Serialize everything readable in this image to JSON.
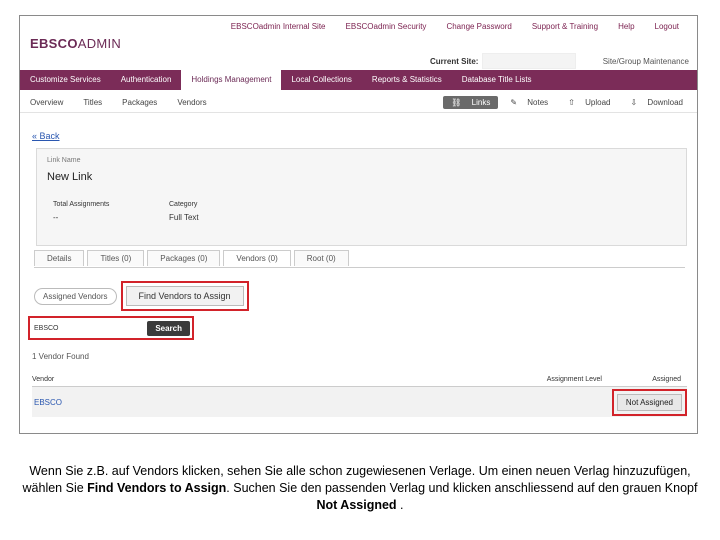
{
  "top_links": [
    "EBSCOadmin Internal Site",
    "EBSCOadmin Security",
    "Change Password",
    "Support & Training",
    "Help",
    "Logout"
  ],
  "logo": {
    "bold": "EBSCO",
    "thin": "ADMIN"
  },
  "current_site_label": "Current Site:",
  "site_group_maintenance": "Site/Group Maintenance",
  "main_nav": [
    "Customize Services",
    "Authentication",
    "Holdings Management",
    "Local Collections",
    "Reports & Statistics",
    "Database Title Lists"
  ],
  "main_nav_active": "Holdings Management",
  "sub_nav": [
    "Overview",
    "Titles",
    "Packages",
    "Vendors"
  ],
  "sub_nav_right": {
    "links": "Links",
    "notes": "Notes",
    "upload": "Upload",
    "download": "Download"
  },
  "back_label": "Back",
  "link_name_label": "Link Name",
  "link_name_value": "New Link",
  "total_assignments_label": "Total Assignments",
  "total_assignments_value": "--",
  "category_label": "Category",
  "category_value": "Full Text",
  "tabs": [
    "Details",
    "Titles (0)",
    "Packages (0)",
    "Vendors (0)",
    "Root (0)"
  ],
  "active_tab": "Vendors (0)",
  "assigned_vendors_label": "Assigned Vendors",
  "find_vendors_label": "Find Vendors to Assign",
  "search_value": "EBSCO",
  "search_button": "Search",
  "found_text": "1 Vendor Found",
  "table_headers": {
    "vendor": "Vendor",
    "assignment_level": "Assignment Level",
    "assigned": "Assigned"
  },
  "rows": [
    {
      "vendor": "EBSCO",
      "assigned_button": "Not Assigned"
    }
  ],
  "caption": {
    "p1": "Wenn Sie z.B. auf Vendors klicken, sehen Sie alle schon zugewiesenen Verlage. Um einen neuen Verlag hinzuzufügen, wählen Sie ",
    "b1": "Find Vendors to Assign",
    "p2": ". Suchen Sie den passenden Verlag und klicken anschliessend auf den grauen Knopf ",
    "b2": "Not Assigned",
    "p3": " ."
  },
  "colors": {
    "nav_bg": "#7b2c58",
    "highlight": "#d2232a",
    "link": "#2a57b0"
  }
}
